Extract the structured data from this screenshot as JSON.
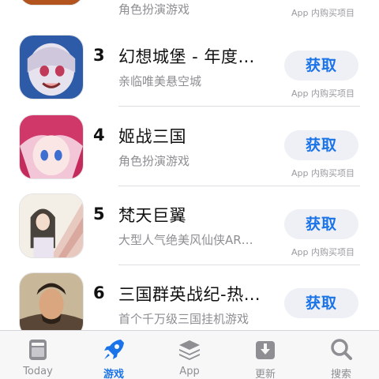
{
  "rows": [
    {
      "rank": "",
      "title": "",
      "subtitle": "角色扮演游戏",
      "button": "获取",
      "iap": "App 内购买项目"
    },
    {
      "rank": "3",
      "title": "幻想城堡 - 年度…",
      "subtitle": "亲临唯美悬空城",
      "button": "获取",
      "iap": "App 内购买项目"
    },
    {
      "rank": "4",
      "title": "姬战三国",
      "subtitle": "角色扮演游戏",
      "button": "获取",
      "iap": "App 内购买项目"
    },
    {
      "rank": "5",
      "title": "梵天巨翼",
      "subtitle": "大型人气绝美风仙侠AR…",
      "button": "获取",
      "iap": "App 内购买项目"
    },
    {
      "rank": "6",
      "title": "三国群英战纪-热…",
      "subtitle": "首个千万级三国挂机游戏",
      "button": "获取",
      "iap": ""
    }
  ],
  "tabbar": {
    "tabs": [
      {
        "label": "Today",
        "icon": "today-icon"
      },
      {
        "label": "游戏",
        "icon": "rocket-icon"
      },
      {
        "label": "App",
        "icon": "layers-icon"
      },
      {
        "label": "更新",
        "icon": "download-tray-icon"
      },
      {
        "label": "搜索",
        "icon": "search-icon"
      }
    ],
    "active_index": 1
  },
  "colors": {
    "accent": "#1a73e8",
    "button_bg": "#eef0f5",
    "secondary_text": "#8e8e93",
    "tab_inactive": "#8e8e93"
  }
}
